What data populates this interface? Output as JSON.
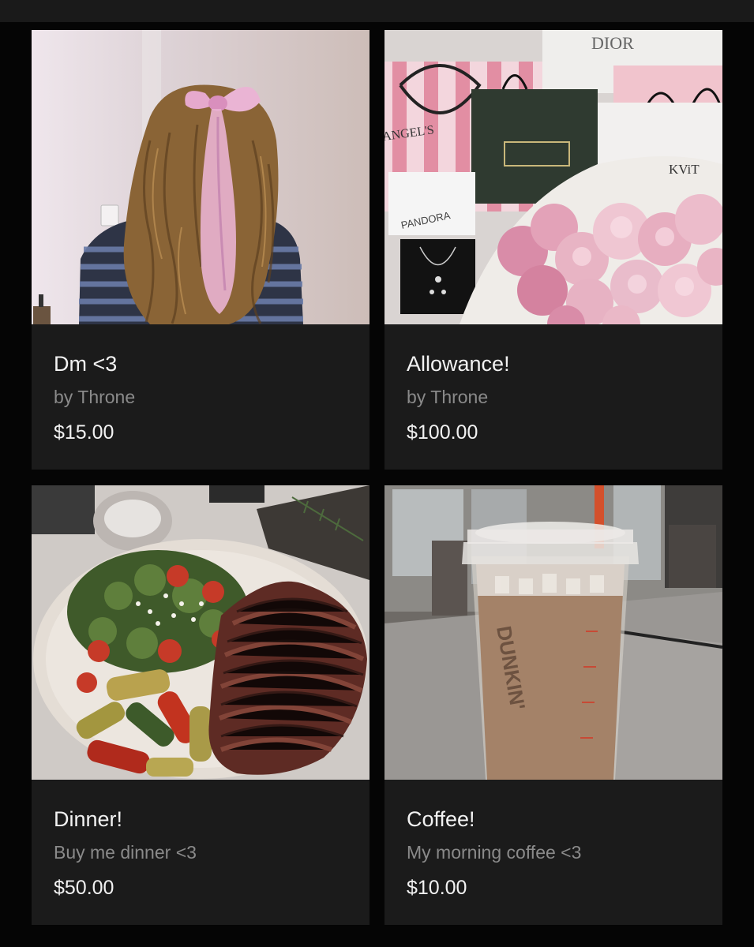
{
  "products": [
    {
      "title": "Dm <3",
      "subtitle": "by Throne",
      "price": "$15.00",
      "image": "girl-with-pink-hair-bow"
    },
    {
      "title": "Allowance!",
      "subtitle": "by Throne",
      "price": "$100.00",
      "image": "shopping-bags-and-peonies",
      "image_text": {
        "brand1": "DIOR",
        "brand2": "PANDORA",
        "brand3": "KViT",
        "bag": "ANGEL'S"
      }
    },
    {
      "title": "Dinner!",
      "subtitle": "Buy me dinner <3",
      "price": "$50.00",
      "image": "steak-and-salad-plate"
    },
    {
      "title": "Coffee!",
      "subtitle": "My morning coffee <3",
      "price": "$10.00",
      "image": "iced-coffee-cup",
      "image_text": {
        "cup": "DUNKIN'"
      }
    }
  ]
}
